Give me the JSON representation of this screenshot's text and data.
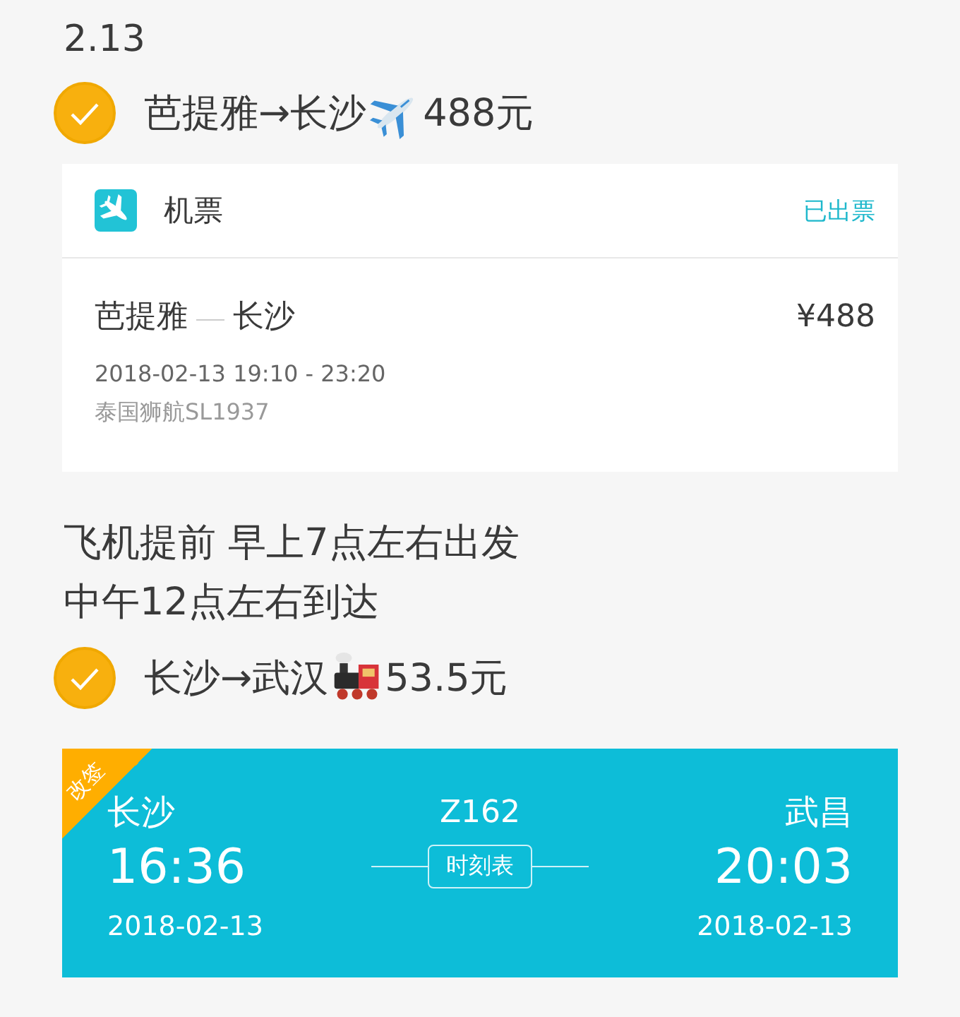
{
  "date": "2.13",
  "flight_todo": {
    "checked": true,
    "route": "芭提雅→长沙",
    "kind": "flight",
    "price": "488元"
  },
  "flight_card": {
    "title": "机票",
    "status": "已出票",
    "from": "芭提雅",
    "to": "长沙",
    "price": "¥488",
    "time": "2018-02-13 19:10 - 23:20",
    "airline": "泰国狮航SL1937"
  },
  "note": [
    "飞机提前 早上7点左右出发",
    "中午12点左右到达"
  ],
  "train_todo": {
    "checked": true,
    "route": "长沙→武汉",
    "kind": "train",
    "price": "53.5元"
  },
  "train_card": {
    "tag": "改签",
    "from": "长沙",
    "depart_time": "16:36",
    "depart_date": "2018-02-13",
    "train_no": "Z162",
    "timetable": "时刻表",
    "to": "武昌",
    "arrive_time": "20:03",
    "arrive_date": "2018-02-13"
  }
}
